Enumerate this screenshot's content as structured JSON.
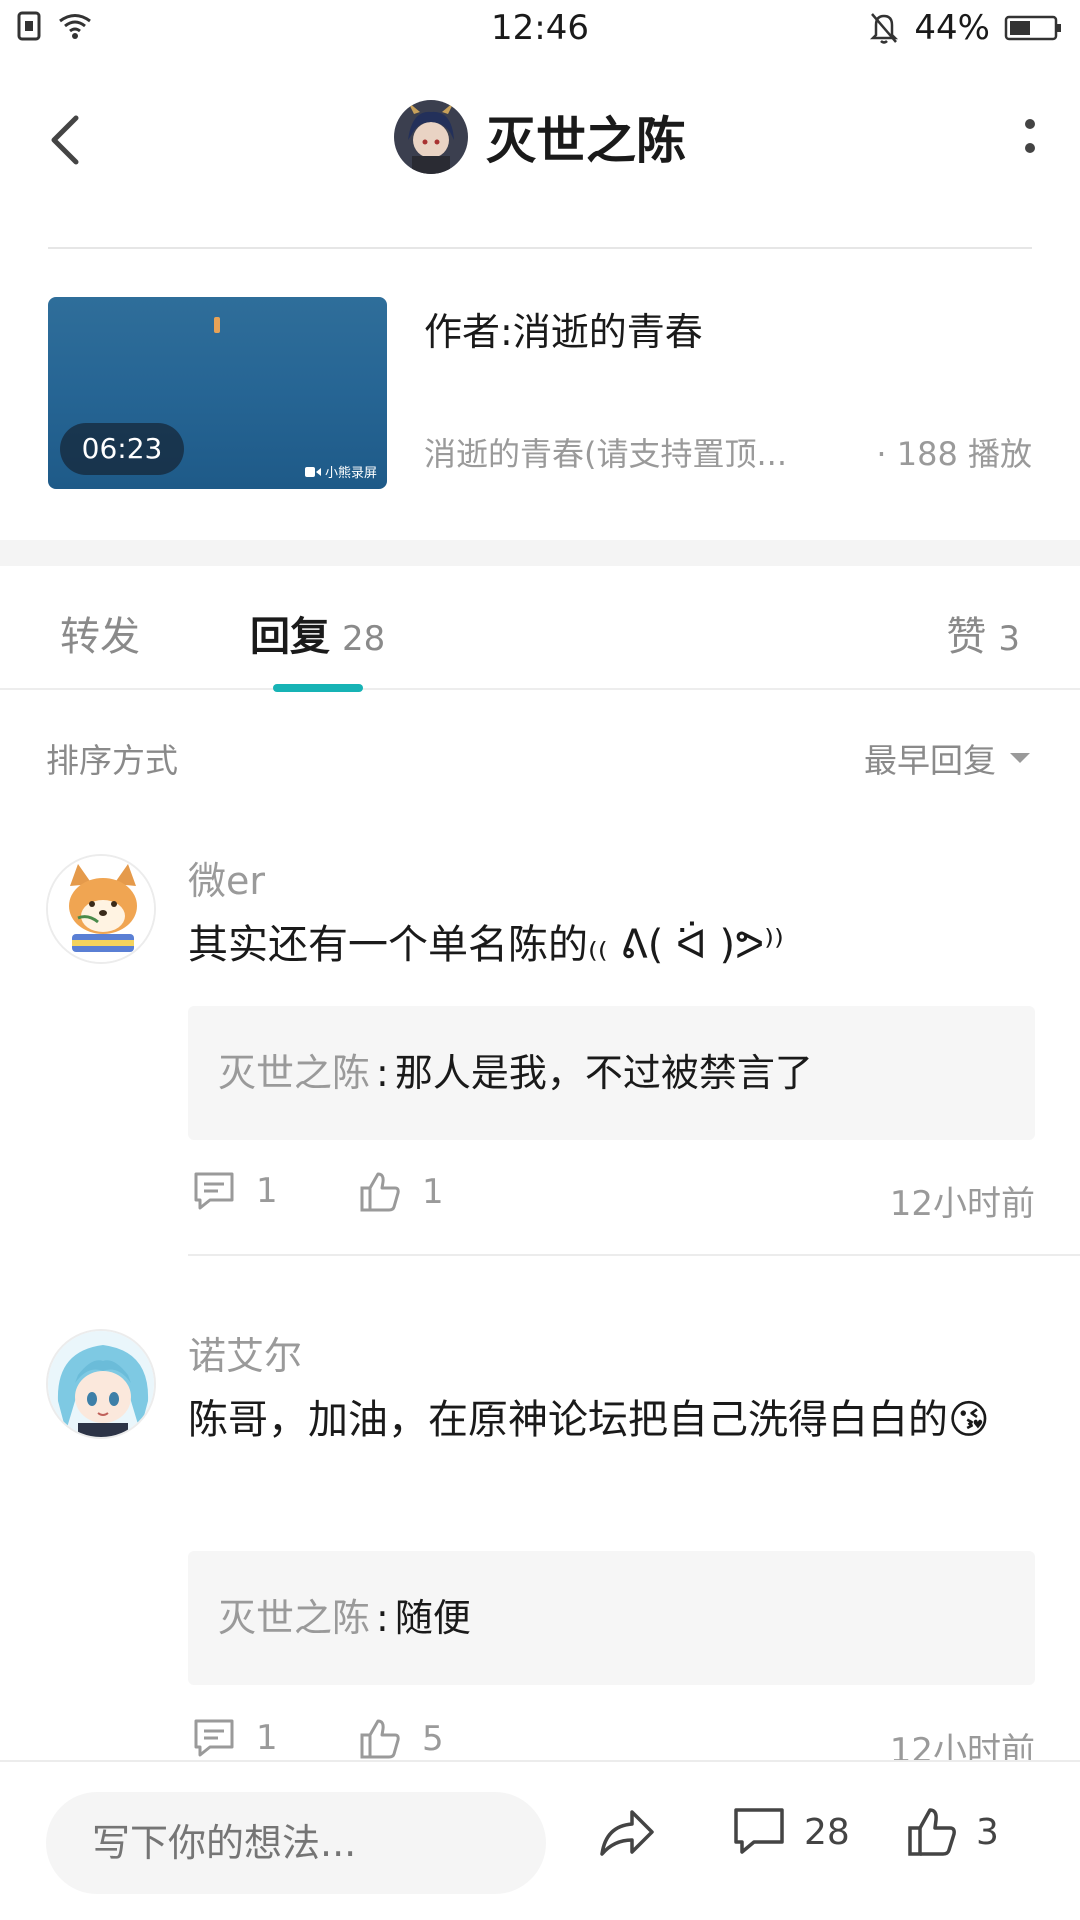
{
  "status_bar": {
    "time": "12:46",
    "battery": "44%",
    "icons": [
      "sim-icon",
      "wifi-icon",
      "bell-mute-icon",
      "battery-icon"
    ]
  },
  "header": {
    "title": "灭世之陈"
  },
  "video": {
    "duration": "06:23",
    "watermark": "小熊录屏",
    "title": "作者:消逝的青春",
    "subtitle": "消逝的青春(请支持置顶...",
    "plays": "· 188 播放"
  },
  "tabs": [
    {
      "label": "转发",
      "count": ""
    },
    {
      "label": "回复",
      "count": "28"
    },
    {
      "label": "赞",
      "count": "3"
    }
  ],
  "sort": {
    "label": "排序方式",
    "value": "最早回复"
  },
  "comments": [
    {
      "user": "微er",
      "text": "其实还有一个单名陈的₍₍ ᕕ( ᐛ )ᕗ⁾⁾",
      "reply_user": "灭世之陈",
      "reply_sep": ":",
      "reply_text": "那人是我，不过被禁言了",
      "replies": "1",
      "likes": "1",
      "time": "12小时前"
    },
    {
      "user": "诺艾尔",
      "text": "陈哥，加油，在原神论坛把自己洗得白白的😘",
      "reply_user": "灭世之陈",
      "reply_sep": ":",
      "reply_text": "随便",
      "replies": "1",
      "likes": "5",
      "time": "12小时前"
    }
  ],
  "bottom_bar": {
    "placeholder": "写下你的想法...",
    "comment_count": "28",
    "like_count": "3"
  },
  "colors": {
    "accent": "#17b3b5",
    "muted_text": "#9a9a9a",
    "reply_bg": "#f6f6f6"
  }
}
